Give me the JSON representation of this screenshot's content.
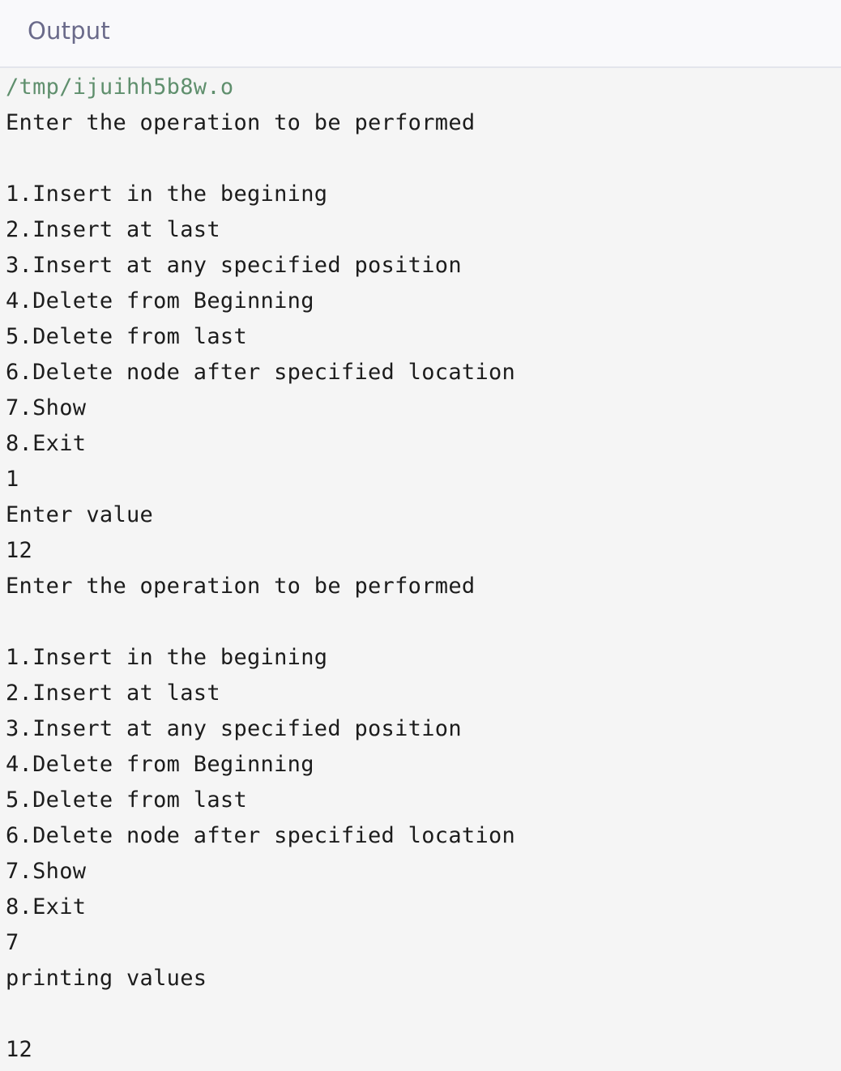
{
  "header": {
    "title": "Output"
  },
  "console": {
    "path": "/tmp/ijuihh5b8w.o",
    "lines": [
      "Enter the operation to be performed",
      "",
      "1.Insert in the begining",
      "2.Insert at last",
      "3.Insert at any specified position",
      "4.Delete from Beginning",
      "5.Delete from last",
      "6.Delete node after specified location",
      "7.Show",
      "8.Exit",
      "1",
      "Enter value",
      "12",
      "Enter the operation to be performed",
      "",
      "1.Insert in the begining",
      "2.Insert at last",
      "3.Insert at any specified position",
      "4.Delete from Beginning",
      "5.Delete from last",
      "6.Delete node after specified location",
      "7.Show",
      "8.Exit",
      "7",
      "printing values",
      "",
      "12"
    ]
  }
}
